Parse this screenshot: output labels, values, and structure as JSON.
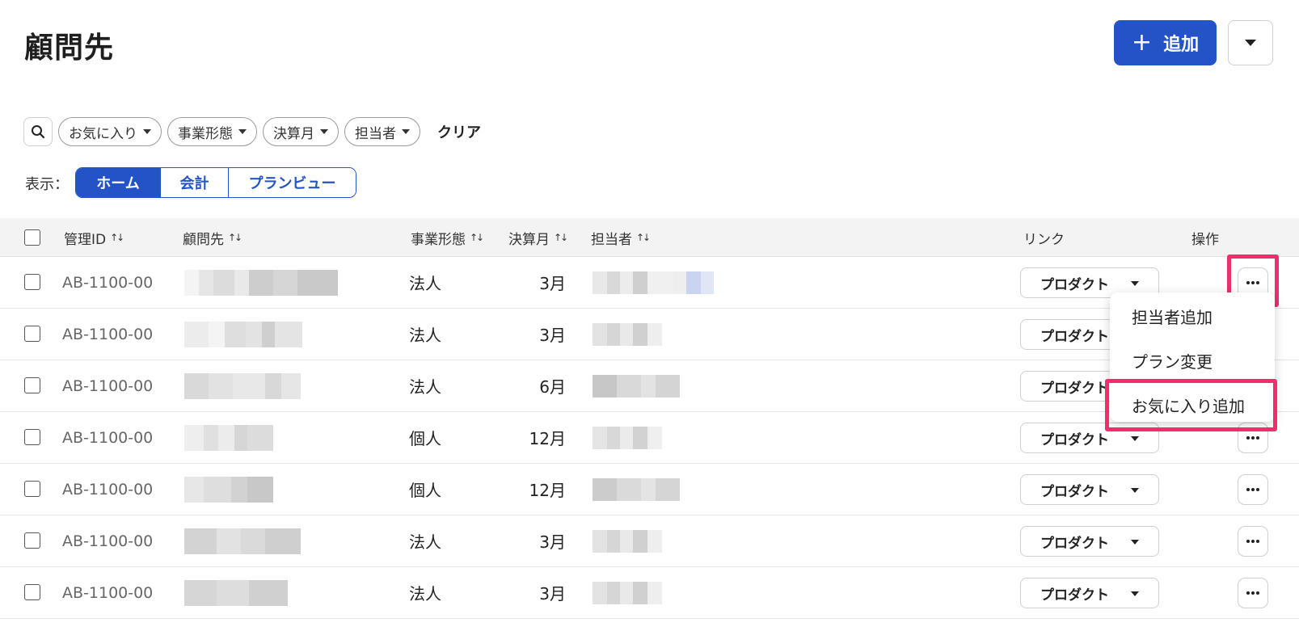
{
  "page": {
    "title": "顧問先"
  },
  "header": {
    "add_label": "追加",
    "add_icon": "plus-icon",
    "more_icon": "caret-down-icon"
  },
  "filters": {
    "search_icon": "search-icon",
    "chips": [
      "お気に入り",
      "事業形態",
      "決算月",
      "担当者"
    ],
    "clear_label": "クリア"
  },
  "view": {
    "label": "表示：",
    "options": [
      "ホーム",
      "会計",
      "プランビュー"
    ],
    "active": "ホーム"
  },
  "table": {
    "headers": {
      "id": "管理ID",
      "client": "顧問先",
      "type": "事業形態",
      "month": "決算月",
      "assignee": "担当者",
      "link": "リンク",
      "ops": "操作"
    },
    "rows": [
      {
        "id": "AB-1100-00",
        "type": "法人",
        "month": "3月",
        "link": "プロダクト"
      },
      {
        "id": "AB-1100-00",
        "type": "法人",
        "month": "3月",
        "link": "プロダクト"
      },
      {
        "id": "AB-1100-00",
        "type": "法人",
        "month": "6月",
        "link": "プロダクト"
      },
      {
        "id": "AB-1100-00",
        "type": "個人",
        "month": "12月",
        "link": "プロダクト"
      },
      {
        "id": "AB-1100-00",
        "type": "個人",
        "month": "12月",
        "link": "プロダクト"
      },
      {
        "id": "AB-1100-00",
        "type": "法人",
        "month": "3月",
        "link": "プロダクト"
      },
      {
        "id": "AB-1100-00",
        "type": "法人",
        "month": "3月",
        "link": "プロダクト"
      }
    ]
  },
  "row_menu": {
    "items": [
      "担当者追加",
      "プラン変更",
      "お気に入り追加"
    ]
  },
  "colors": {
    "accent": "#2453c7",
    "highlight": "#ee2f6b"
  }
}
